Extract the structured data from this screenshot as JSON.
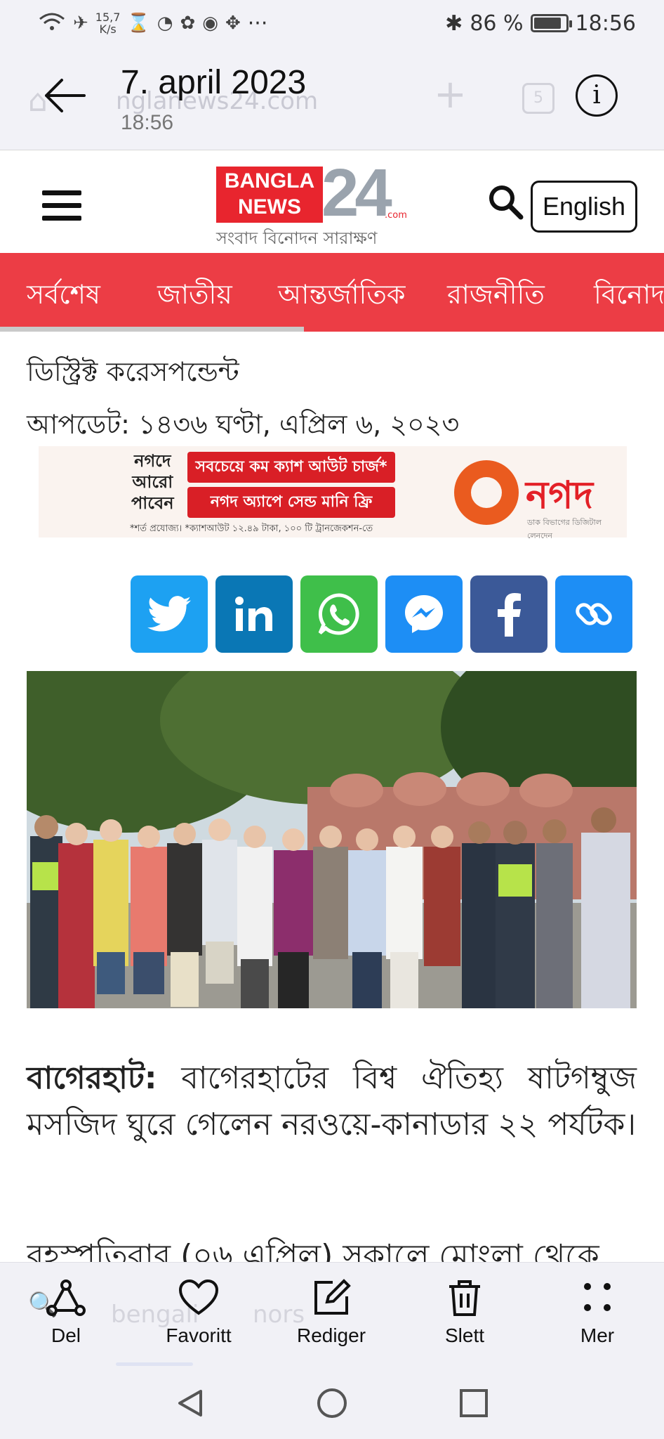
{
  "status_bar": {
    "speed_value": "15,7",
    "speed_unit": "K/s",
    "overflow": "···",
    "battery_percent": "86 %",
    "battery_level": 0.86,
    "time": "18:56"
  },
  "viewer": {
    "date_title": "7. april 2023",
    "time": "18:56",
    "ghost_url": "nglanews24.com",
    "ghost_tabs_count": "5"
  },
  "site": {
    "logo_line1": "BANGLA",
    "logo_line2": "NEWS",
    "logo_number": "24",
    "logo_domain": ".com",
    "logo_tagline": "সংবাদ বিনোদন সারাক্ষণ",
    "language_button": "English"
  },
  "categories": [
    "সর্বশেষ",
    "জাতীয়",
    "আন্তর্জাতিক",
    "রাজনীতি",
    "বিনোদ"
  ],
  "article": {
    "byline": "ডিস্ট্রিক্ট করেসপন্ডেন্ট",
    "updated": "আপডেট: ১৪৩৬ ঘণ্টা, এপ্রিল ৬, ২০২৩",
    "lead_place": "বাগেরহাট:",
    "lead_text": " বাগেরহাটের বিশ্ব ঐতিহ্য ষাটগম্বুজ মসজিদ ঘুরে গেলেন নরওয়ে-কানাডার ২২ পর্যটক।",
    "para2_cut": "বৃহস্পতিবার (০৬ এপ্রিল) সকালে মোংলা থেকে"
  },
  "ad": {
    "left_line1": "নগদে",
    "left_line2": "আরো",
    "left_line3": "পাবেন",
    "pill1": "সবচেয়ে কম ক্যাশ আউট চার্জ*",
    "pill2": "নগদ অ্যাপে সেন্ড মানি ফ্রি",
    "fine_print": "*শর্ত প্রযোজ্য। *ক্যাশআউট ১২.৪৯ টাকা, ১০০ টি ট্রানজেকশন-তে",
    "brand": "নগদ",
    "brand_sub": "ডাক বিভাগের ডিজিটাল লেনদেন"
  },
  "share": [
    {
      "icon": "twitter-icon",
      "color": "#1da1f2"
    },
    {
      "icon": "linkedin-icon",
      "color": "#0a77b5"
    },
    {
      "icon": "whatsapp-icon",
      "color": "#3fbf4a"
    },
    {
      "icon": "messenger-icon",
      "color": "#1d8ef5"
    },
    {
      "icon": "facebook-icon",
      "color": "#3b5998"
    },
    {
      "icon": "copy-link-icon",
      "color": "#1d8ef5"
    }
  ],
  "actions": {
    "share": "Del",
    "favorite": "Favoritt",
    "edit": "Rediger",
    "delete": "Slett",
    "more": "Mer",
    "ghost_search_1": "bengali",
    "ghost_search_2": "nors"
  },
  "colors": {
    "brand_red": "#ec3d45",
    "chrome_bg": "#f2f2f7"
  }
}
